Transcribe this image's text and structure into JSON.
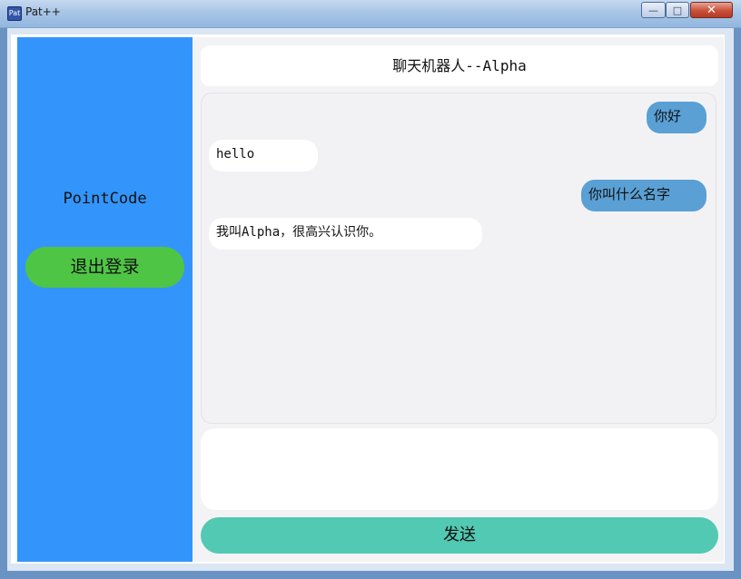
{
  "window": {
    "title": "Pat++",
    "icon": "Pat",
    "minimize_glyph": "—",
    "maximize_glyph": "□",
    "close_glyph": "✕"
  },
  "sidebar": {
    "username": "PointCode",
    "logout_label": "退出登录"
  },
  "chat": {
    "title": "聊天机器人--Alpha",
    "messages": [
      {
        "role": "user",
        "text": "你好"
      },
      {
        "role": "bot",
        "text": "hello"
      },
      {
        "role": "user",
        "text": "你叫什么名字"
      },
      {
        "role": "bot",
        "text": "我叫Alpha，很高兴认识你。"
      }
    ]
  },
  "composer": {
    "value": "",
    "send_label": "发送"
  },
  "colors": {
    "sidebar": "#3395fb",
    "logout_button": "#4fc545",
    "user_bubble": "#5aa0d5",
    "bot_bubble": "#ffffff",
    "send_button": "#52c9b2"
  }
}
